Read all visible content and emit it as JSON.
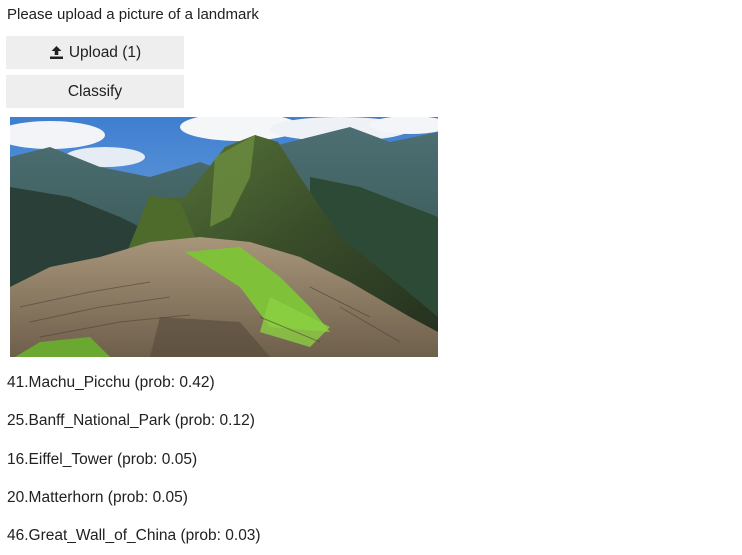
{
  "prompt": "Please upload a picture of a landmark",
  "upload_button": {
    "label": "Upload (1)",
    "icon": "upload-icon"
  },
  "classify_button": {
    "label": "Classify"
  },
  "image": {
    "subject": "Machu Picchu mountain ruins photo"
  },
  "predictions": [
    "41.Machu_Picchu (prob: 0.42)",
    "25.Banff_National_Park (prob: 0.12)",
    "16.Eiffel_Tower (prob: 0.05)",
    "20.Matterhorn (prob: 0.05)",
    "46.Great_Wall_of_China (prob: 0.03)"
  ]
}
